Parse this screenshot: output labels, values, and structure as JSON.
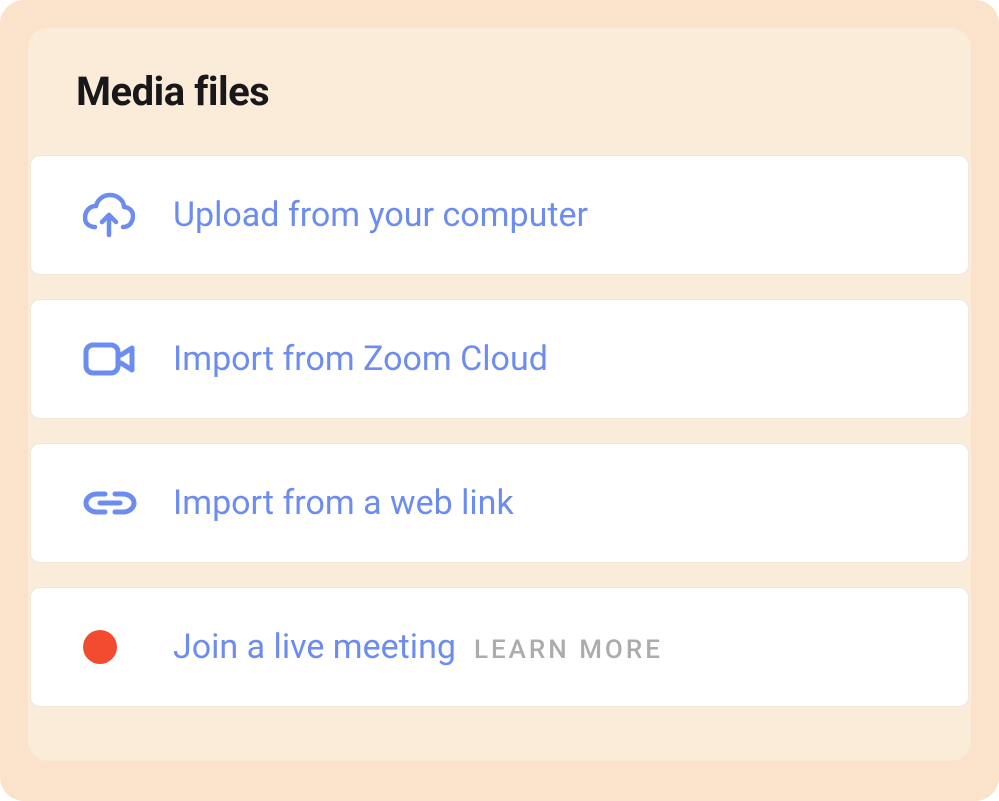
{
  "panel": {
    "title": "Media files"
  },
  "options": {
    "upload": {
      "label": "Upload from your computer",
      "icon": "cloud-upload-icon"
    },
    "zoom": {
      "label": "Import from Zoom Cloud",
      "icon": "video-camera-icon"
    },
    "weblink": {
      "label": "Import from a web link",
      "icon": "link-icon"
    },
    "live": {
      "label": "Join a live meeting",
      "learn_more": "LEARN MORE",
      "icon": "record-dot-icon"
    }
  },
  "colors": {
    "accent": "#6d8cf0",
    "outer_bg": "#fbe2ca",
    "inner_bg": "#fbebd9",
    "record": "#f34b2f",
    "muted": "#aeacaa"
  }
}
